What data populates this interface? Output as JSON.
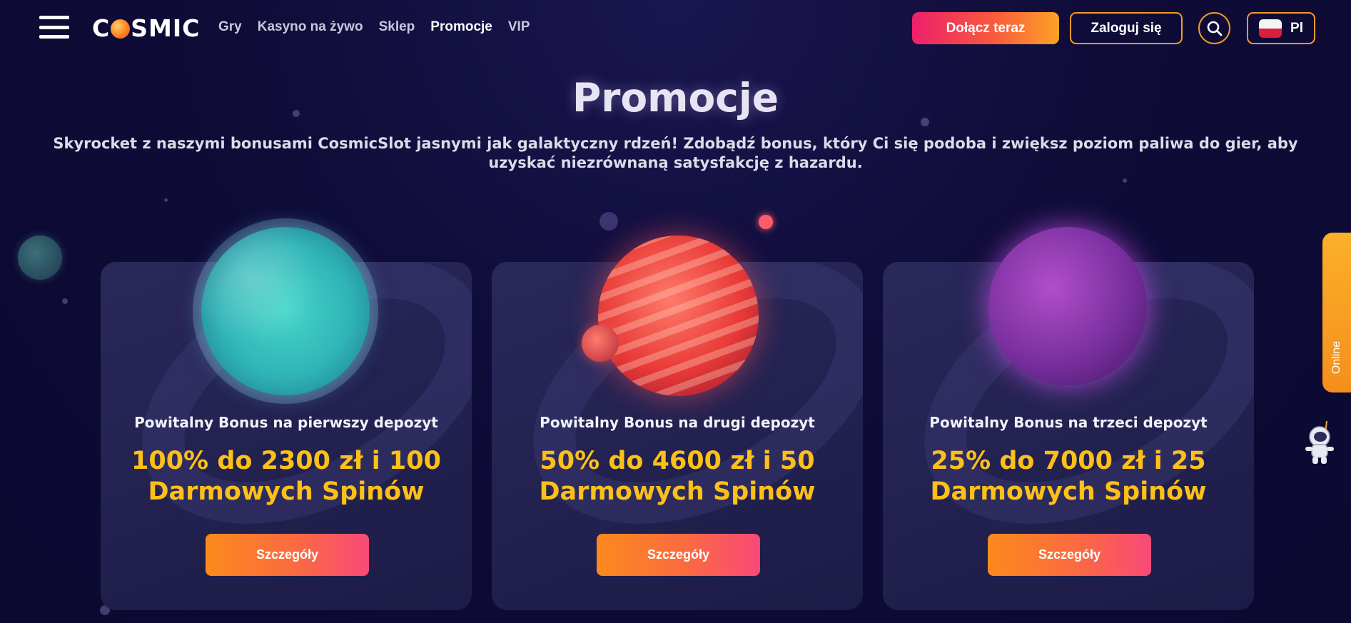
{
  "header": {
    "logo": "COSMIC",
    "nav": [
      {
        "label": "Gry",
        "active": false
      },
      {
        "label": "Kasyno na żywo",
        "active": false
      },
      {
        "label": "Sklep",
        "active": false
      },
      {
        "label": "Promocje",
        "active": true
      },
      {
        "label": "VIP",
        "active": false
      }
    ],
    "join_label": "Dołącz teraz",
    "login_label": "Zaloguj się",
    "lang_label": "Pl"
  },
  "page": {
    "title": "Promocje",
    "subtitle": "Skyrocket z naszymi bonusami CosmicSlot jasnymi jak galaktyczny rdzeń! Zdobądź bonus, który Ci się podoba i zwiększ poziom paliwa do gier, aby uzyskać niezrównaną satysfakcję z hazardu."
  },
  "cards": [
    {
      "label": "Powitalny Bonus na pierwszy depozyt",
      "value": "100% do 2300 zł i 100 Darmowych Spinów",
      "button": "Szczegóły"
    },
    {
      "label": "Powitalny Bonus na drugi depozyt",
      "value": "50% do 4600 zł i 50 Darmowych Spinów",
      "button": "Szczegóły"
    },
    {
      "label": "Powitalny Bonus na trzeci depozyt",
      "value": "25% do 7000 zł i 25 Darmowych Spinów",
      "button": "Szczegóły"
    }
  ],
  "online_tab": {
    "label": "Online"
  },
  "icons": {
    "menu": "hamburger-menu-icon",
    "search": "search-icon",
    "flag": "poland-flag-icon",
    "support": "astronaut-icon"
  },
  "colors": {
    "background": "#0f0c38",
    "accent_orange": "#f79a2a",
    "bonus_yellow": "#fcc019",
    "join_gradient_start": "#ee1f6b"
  }
}
